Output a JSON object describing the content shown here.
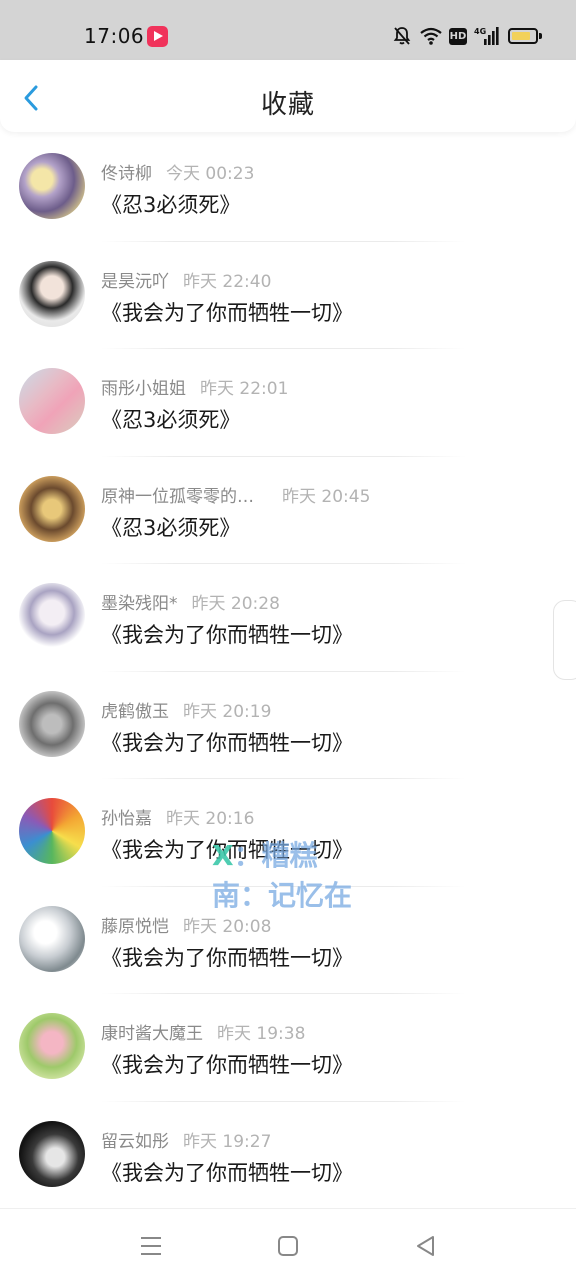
{
  "status_bar": {
    "time": "17:06",
    "icons": [
      "app-notification-icon",
      "bell-off-icon",
      "wifi-icon",
      "hd-icon",
      "4g-signal-icon",
      "battery-icon"
    ],
    "hd_label": "HD",
    "network_label": "4G"
  },
  "header": {
    "title": "收藏",
    "back_icon": "chevron-left-icon",
    "accent_color": "#2a9bde"
  },
  "items": [
    {
      "user": "佟诗柳",
      "time": "今天 00:23",
      "title": "《忍3必须死》"
    },
    {
      "user": "是昊沅吖",
      "time": "昨天 22:40",
      "title": "《我会为了你而牺牲一切》"
    },
    {
      "user": "雨彤小姐姐",
      "time": "昨天 22:01",
      "title": "《忍3必须死》"
    },
    {
      "user": "原神一位孤零零的…",
      "time": "昨天 20:45",
      "title": "《忍3必须死》"
    },
    {
      "user": "墨染残阳*",
      "time": "昨天 20:28",
      "title": "《我会为了你而牺牲一切》"
    },
    {
      "user": "虎鹤傲玉",
      "time": "昨天 20:19",
      "title": "《我会为了你而牺牲一切》"
    },
    {
      "user": "孙怡嘉",
      "time": "昨天 20:16",
      "title": "《我会为了你而牺牲一切》"
    },
    {
      "user": "藤原悦恺",
      "time": "昨天 20:08",
      "title": "《我会为了你而牺牲一切》"
    },
    {
      "user": "康时酱大魔王",
      "time": "昨天 19:38",
      "title": "《我会为了你而牺牲一切》"
    },
    {
      "user": "留云如彤",
      "time": "昨天 19:27",
      "title": "《我会为了你而牺牲一切》"
    }
  ],
  "watermark": {
    "line1_mark": "X",
    "line1_text": "：糟糕",
    "line2": "南：记忆在"
  },
  "nav_bar": {
    "icons": [
      "menu-icon",
      "home-square-icon",
      "back-triangle-icon"
    ]
  }
}
